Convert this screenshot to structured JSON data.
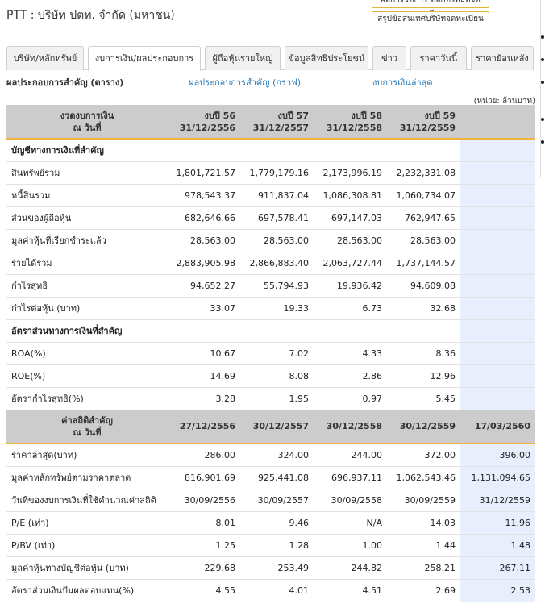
{
  "page": {
    "company_title": "PTT : บริษัท ปตท. จำกัด (มหาชน)",
    "top_buttons": [
      "ผลการจัดการ หลักทรัพย์ที่จดทะเบียน",
      "สรุปข้อสนเทศบริษัทจดทะเบียน"
    ]
  },
  "tabs": [
    {
      "label": "บริษัท/หลักทรัพย์",
      "active": false
    },
    {
      "label": "งบการเงิน/ผลประกอบการ",
      "active": true
    },
    {
      "label": "ผู้ถือหุ้นรายใหญ่",
      "active": false
    },
    {
      "label": "ข้อมูลสิทธิประโยชน์",
      "active": false
    },
    {
      "label": "ข่าว",
      "active": false
    },
    {
      "label": "ราคาวันนี้",
      "active": false
    },
    {
      "label": "ราคาย้อนหลัง",
      "active": false
    }
  ],
  "sub_links": {
    "current": "ผลประกอบการสำคัญ (ตาราง)",
    "graph_link": "ผลประกอบการสำคัญ (กราฟ)",
    "latest_link": "งบการเงินล่าสุด"
  },
  "unit_label": "(หน่วย: ล้านบาท)",
  "financials": {
    "header": {
      "label_line1": "งวดงบการเงิน",
      "label_line2": "ณ วันที่",
      "periods": [
        {
          "line1": "งบปี 56",
          "line2": "31/12/2556"
        },
        {
          "line1": "งบปี 57",
          "line2": "31/12/2557"
        },
        {
          "line1": "งบปี 58",
          "line2": "31/12/2558"
        },
        {
          "line1": "งบปี 59",
          "line2": "31/12/2559"
        }
      ]
    },
    "section1": "บัญชีทางการเงินที่สำคัญ",
    "rows1": [
      {
        "label": "สินทรัพย์รวม",
        "values": [
          "1,801,721.57",
          "1,779,179.16",
          "2,173,996.19",
          "2,232,331.08"
        ]
      },
      {
        "label": "หนี้สินรวม",
        "values": [
          "978,543.37",
          "911,837.04",
          "1,086,308.81",
          "1,060,734.07"
        ]
      },
      {
        "label": "ส่วนของผู้ถือหุ้น",
        "values": [
          "682,646.66",
          "697,578.41",
          "697,147.03",
          "762,947.65"
        ]
      },
      {
        "label": "มูลค่าหุ้นที่เรียกชำระแล้ว",
        "values": [
          "28,563.00",
          "28,563.00",
          "28,563.00",
          "28,563.00"
        ]
      },
      {
        "label": "รายได้รวม",
        "values": [
          "2,883,905.98",
          "2,866,883.40",
          "2,063,727.44",
          "1,737,144.57"
        ]
      },
      {
        "label": "กำไรสุทธิ",
        "values": [
          "94,652.27",
          "55,794.93",
          "19,936.42",
          "94,609.08"
        ]
      },
      {
        "label": "กำไรต่อหุ้น (บาท)",
        "values": [
          "33.07",
          "19.33",
          "6.73",
          "32.68"
        ]
      }
    ],
    "section2": "อัตราส่วนทางการเงินที่สำคัญ",
    "rows2": [
      {
        "label": "ROA(%)",
        "values": [
          "10.67",
          "7.02",
          "4.33",
          "8.36"
        ]
      },
      {
        "label": "ROE(%)",
        "values": [
          "14.69",
          "8.08",
          "2.86",
          "12.96"
        ]
      },
      {
        "label": "อัตรากำไรสุทธิ(%)",
        "values": [
          "3.28",
          "1.95",
          "0.97",
          "5.45"
        ]
      }
    ]
  },
  "statistics": {
    "header": {
      "label_line1": "ค่าสถิติสำคัญ",
      "label_line2": "ณ วันที่",
      "dates": [
        "27/12/2556",
        "30/12/2557",
        "30/12/2558",
        "30/12/2559",
        "17/03/2560"
      ]
    },
    "rows": [
      {
        "label": "ราคาล่าสุด(บาท)",
        "values": [
          "286.00",
          "324.00",
          "244.00",
          "372.00",
          "396.00"
        ]
      },
      {
        "label": "มูลค่าหลักทรัพย์ตามราคาตลาด",
        "values": [
          "816,901.69",
          "925,441.08",
          "696,937.11",
          "1,062,543.46",
          "1,131,094.65"
        ]
      },
      {
        "label": "วันที่ของงบการเงินที่ใช้คำนวณค่าสถิติ",
        "values": [
          "30/09/2556",
          "30/09/2557",
          "30/09/2558",
          "30/09/2559",
          "31/12/2559"
        ]
      },
      {
        "label": "P/E (เท่า)",
        "values": [
          "8.01",
          "9.46",
          "N/A",
          "14.03",
          "11.96"
        ]
      },
      {
        "label": "P/BV (เท่า)",
        "values": [
          "1.25",
          "1.28",
          "1.00",
          "1.44",
          "1.48"
        ]
      },
      {
        "label": "มูลค่าหุ้นทางบัญชีต่อหุ้น (บาท)",
        "values": [
          "229.68",
          "253.49",
          "244.82",
          "258.21",
          "267.11"
        ]
      },
      {
        "label": "อัตราส่วนเงินปันผลตอบแทน(%)",
        "values": [
          "4.55",
          "4.01",
          "4.51",
          "2.69",
          "2.53"
        ]
      }
    ]
  }
}
